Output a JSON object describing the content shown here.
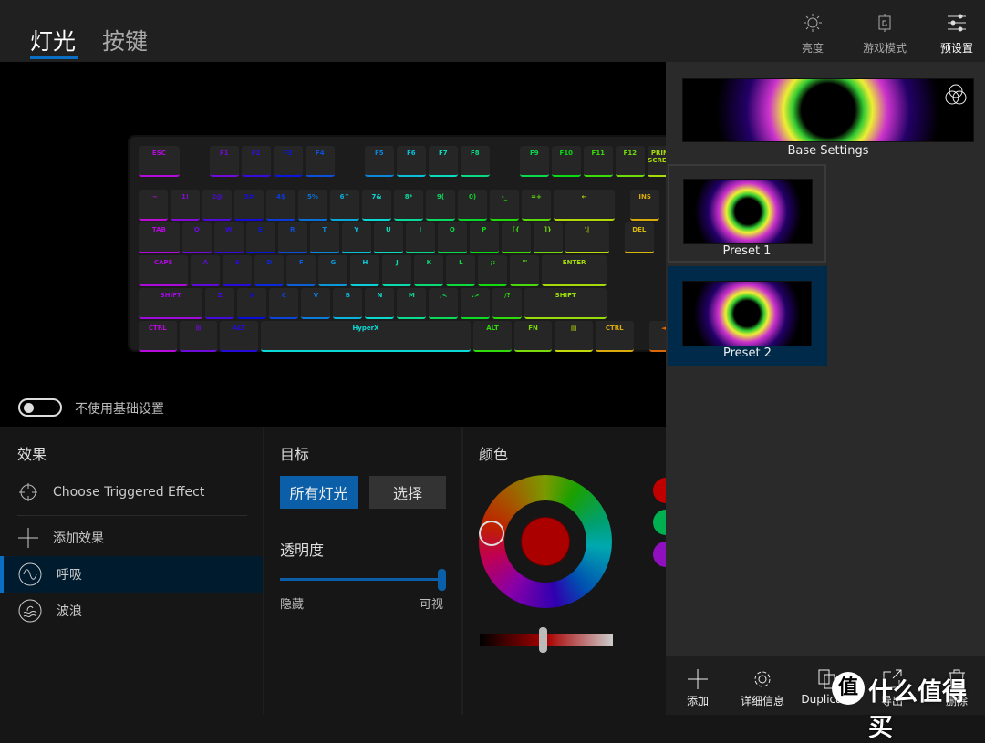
{
  "header": {
    "tabs": [
      {
        "label": "灯光",
        "active": true
      },
      {
        "label": "按键",
        "active": false
      }
    ],
    "actions": [
      {
        "label": "亮度",
        "icon": "brightness-icon"
      },
      {
        "label": "游戏模式",
        "icon": "game-mode-icon"
      },
      {
        "label": "预设置",
        "icon": "sliders-icon"
      }
    ]
  },
  "keyboard": {
    "rows": [
      [
        "ESC",
        "F1",
        "F2",
        "F3",
        "F4",
        "F5",
        "F6",
        "F7",
        "F8",
        "F9",
        "F10",
        "F11",
        "F12",
        "PRINT SCREEN"
      ],
      [
        "`~",
        "1!",
        "2@",
        "3#",
        "4$",
        "5%",
        "6^",
        "7&",
        "8*",
        "9(",
        "0)",
        "-_",
        "=+",
        "←",
        "INS"
      ],
      [
        "TAB",
        "Q",
        "W",
        "E",
        "R",
        "T",
        "Y",
        "U",
        "I",
        "O",
        "P",
        "[{",
        "]}",
        "\\|",
        "DEL"
      ],
      [
        "CAPS",
        "A",
        "S",
        "D",
        "F",
        "G",
        "H",
        "J",
        "K",
        "L",
        ";:",
        "'\"",
        "ENTER"
      ],
      [
        "SHIFT",
        "Z",
        "X",
        "C",
        "V",
        "B",
        "N",
        "M",
        ",<",
        ".>",
        "/?",
        "SHIFT"
      ],
      [
        "CTRL",
        "⊞",
        "ALT",
        "HX",
        "ALT",
        "FN",
        "▤",
        "CTRL",
        "◄"
      ]
    ]
  },
  "base_toggle": {
    "label": "不使用基础设置",
    "on": false
  },
  "effects": {
    "title": "效果",
    "items": [
      {
        "label": "Choose Triggered Effect",
        "icon": "crosshair-icon"
      },
      {
        "label": "添加效果",
        "icon": "plus-icon"
      },
      {
        "label": "呼吸",
        "icon": "sine-wave-icon",
        "selected": true
      },
      {
        "label": "波浪",
        "icon": "wave-icon"
      }
    ]
  },
  "target": {
    "title": "目标",
    "all_lights": "所有灯光",
    "select": "选择",
    "opacity_title": "透明度",
    "opacity_min": "隐藏",
    "opacity_max": "可视",
    "opacity_value": 100
  },
  "color": {
    "title": "颜色",
    "selected": "#aa0000",
    "swatches": [
      "#c00000",
      "#00b050",
      "#9010c0"
    ],
    "brightness": 48
  },
  "presets": [
    {
      "label": "Base Settings"
    },
    {
      "label": "Preset 1"
    },
    {
      "label": "Preset 2",
      "selected": true
    }
  ],
  "footer": [
    {
      "label": "添加",
      "icon": "plus-icon"
    },
    {
      "label": "详细信息",
      "icon": "gear-icon"
    },
    {
      "label": "Duplicate",
      "icon": "duplicate-icon"
    },
    {
      "label": "导出",
      "icon": "export-icon"
    },
    {
      "label": "删除",
      "icon": "trash-icon"
    }
  ],
  "watermark": "值 什么值得买",
  "colors": {
    "accent": "#0a6fc2",
    "selected_bg": "#002a4a"
  }
}
